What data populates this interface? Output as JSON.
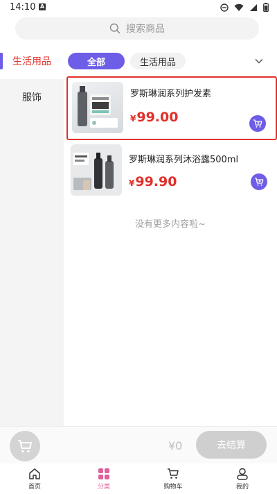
{
  "status_bar": {
    "time": "14:10",
    "notification_glyph": "A"
  },
  "search": {
    "placeholder": "搜索商品"
  },
  "sidebar": {
    "items": [
      {
        "label": "生活用品",
        "active": true
      },
      {
        "label": "服饰",
        "active": false
      }
    ]
  },
  "tabs": [
    {
      "label": "全部",
      "active": true
    },
    {
      "label": "生活用品",
      "active": false
    }
  ],
  "products": [
    {
      "name": "罗斯琳润系列护发素",
      "currency": "¥",
      "price": "99.00",
      "selected": true
    },
    {
      "name": "罗斯琳润系列沐浴露500ml",
      "currency": "¥",
      "price": "99.90",
      "selected": false
    }
  ],
  "list_end_text": "没有更多内容啦~",
  "checkout": {
    "total": "¥0",
    "button_label": "去结算"
  },
  "bottom_nav": [
    {
      "label": "首页",
      "icon": "home-icon",
      "active": false
    },
    {
      "label": "分类",
      "icon": "category-icon",
      "active": true
    },
    {
      "label": "购物车",
      "icon": "cart-icon",
      "active": false
    },
    {
      "label": "我的",
      "icon": "profile-icon",
      "active": false
    }
  ],
  "colors": {
    "accent": "#6e5de6",
    "price": "#e0302a",
    "nav_active": "#e0609a"
  }
}
